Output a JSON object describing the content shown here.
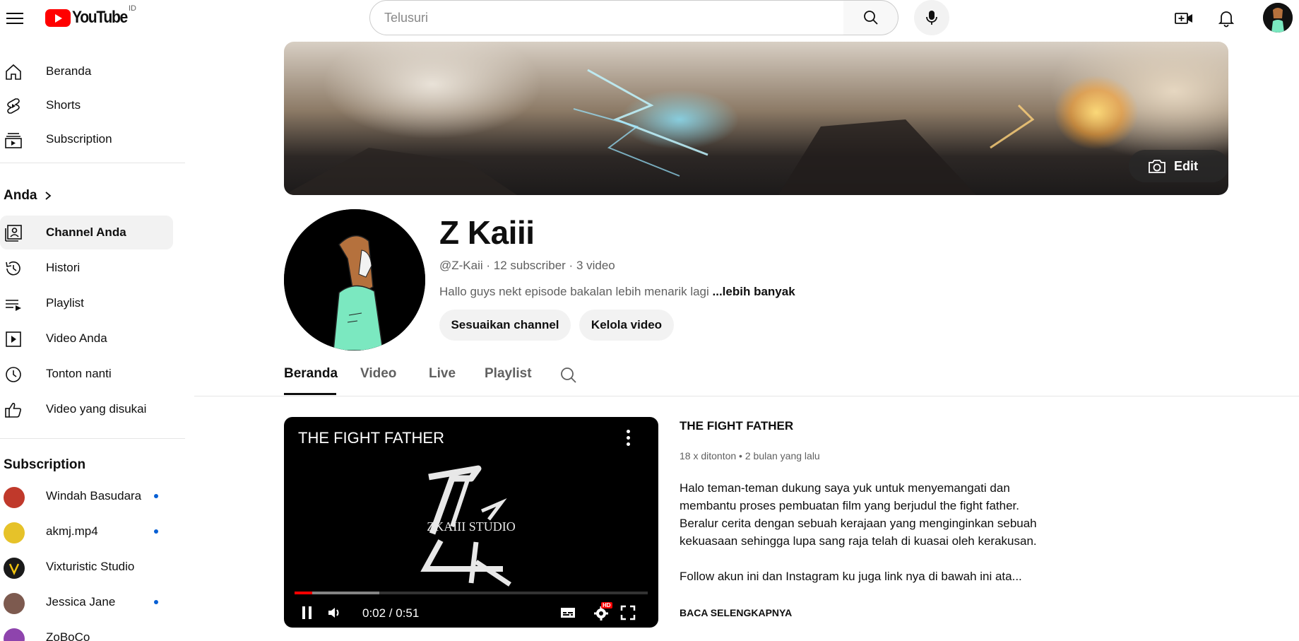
{
  "header": {
    "logo_text": "YouTube",
    "country_code": "ID",
    "search_placeholder": "Telusuri"
  },
  "sidebar": {
    "main_items": [
      {
        "label": "Beranda",
        "icon": "home-icon"
      },
      {
        "label": "Shorts",
        "icon": "shorts-icon"
      },
      {
        "label": "Subscription",
        "icon": "subscriptions-icon"
      }
    ],
    "you_heading": "Anda",
    "you_items": [
      {
        "label": "Channel Anda",
        "icon": "channel-icon",
        "active": true
      },
      {
        "label": "Histori",
        "icon": "history-icon"
      },
      {
        "label": "Playlist",
        "icon": "playlist-icon"
      },
      {
        "label": "Video Anda",
        "icon": "your-videos-icon"
      },
      {
        "label": "Tonton nanti",
        "icon": "watch-later-icon"
      },
      {
        "label": "Video yang disukai",
        "icon": "liked-icon"
      }
    ],
    "subs_heading": "Subscription",
    "subscriptions": [
      {
        "name": "Windah Basudara",
        "new": true,
        "color": "#c0392b"
      },
      {
        "name": "akmj.mp4",
        "new": true,
        "color": "#e6c229"
      },
      {
        "name": "Vixturistic Studio",
        "new": false,
        "color": "#1a1a1a"
      },
      {
        "name": "Jessica Jane",
        "new": true,
        "color": "#7d5a4f"
      },
      {
        "name": "ZoBoCo",
        "new": false,
        "color": "#8e44ad"
      }
    ]
  },
  "banner": {
    "edit_label": "Edit"
  },
  "channel": {
    "name": "Z Kaiii",
    "handle": "@Z-Kaii",
    "subscribers": "12 subscriber",
    "videos": "3 video",
    "description": "Hallo guys nekt episode bakalan lebih menarik lagi ",
    "more_label": "...lebih banyak",
    "customize_label": "Sesuaikan channel",
    "manage_label": "Kelola video"
  },
  "tabs": [
    {
      "label": "Beranda",
      "active": true
    },
    {
      "label": "Video",
      "active": false
    },
    {
      "label": "Live",
      "active": false
    },
    {
      "label": "Playlist",
      "active": false
    }
  ],
  "player": {
    "title": "THE FIGHT FATHER",
    "logo_text": "ZKAIII STUDIO",
    "time": "0:02 / 0:51",
    "progress_played": 0.05,
    "progress_buffered": 0.24,
    "hd_badge": "HD"
  },
  "featured_video": {
    "title": "THE FIGHT FATHER",
    "views": "18 x ditonton",
    "age": "2 bulan yang lalu",
    "description_p1": "Halo teman-teman dukung saya yuk untuk menyemangati dan membantu proses pembuatan film yang berjudul the fight father. Beralur cerita dengan sebuah kerajaan yang menginginkan sebuah kekuasaan sehingga lupa sang raja telah di kuasai oleh kerakusan.",
    "description_p2": "Follow akun ini dan Instagram ku juga link nya di bawah ini ata...",
    "read_more": "BACA SELENGKAPNYA"
  },
  "colors": {
    "brand_red": "#ff0000",
    "text_primary": "#0f0f0f",
    "text_secondary": "#606060",
    "chip_bg": "#f2f2f2",
    "new_dot": "#065fd4",
    "avatar_shirt": "#7be8c0",
    "avatar_hair": "#b5713d"
  }
}
